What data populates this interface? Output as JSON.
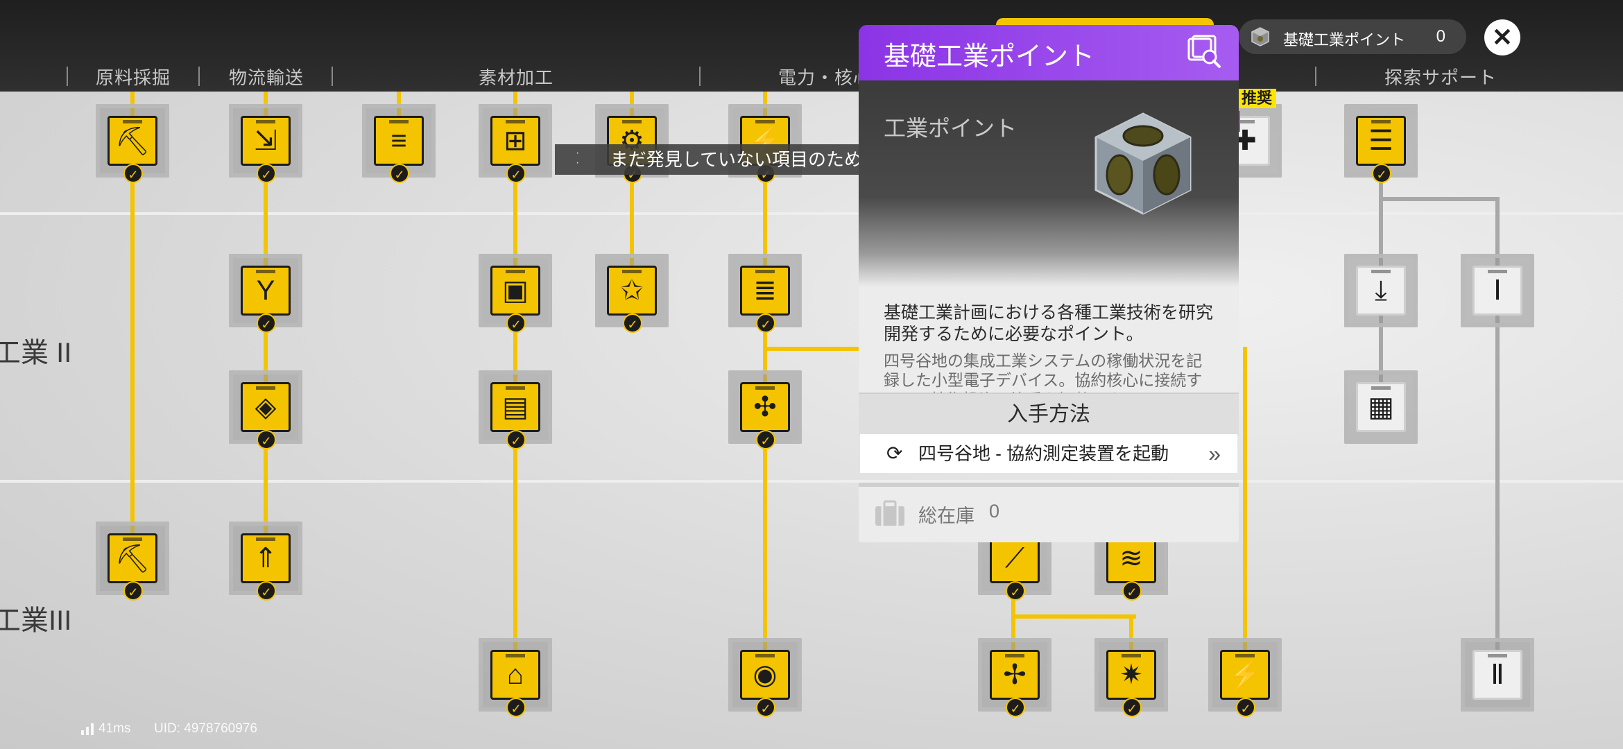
{
  "columns": [
    "原料採掘",
    "物流輸送",
    "素材加工",
    "電力・核心",
    "探索サポート"
  ],
  "row_labels": [
    "工業 II",
    "工業III"
  ],
  "toast": "まだ発見していない項目のため、移動できません",
  "popup": {
    "title": "基礎工業ポイント",
    "category": "工業ポイント",
    "description": "基礎工業計画における各種工業技術を研究開発するために必要なポイント。",
    "flavor": "四号谷地の集成工業システムの稼働状況を記録した小型電子デバイス。協約核心に接続すると、技術投資の比重を調整できる。",
    "acquisition_title": "入手方法",
    "acquisition_item": "四号谷地 - 協約測定装置を起動",
    "stock_label": "総在庫",
    "stock_value": "0"
  },
  "points": {
    "label": "基礎工業ポイント",
    "value": "0"
  },
  "recommend": "推奨",
  "footer": {
    "ping": "41ms",
    "uid": "UID: 4978760976"
  },
  "colors": {
    "accent_yellow": "#f5c400",
    "popup_purple": "#9a4cec",
    "dark_bar": "#222222"
  },
  "icons": {
    "close": "close-icon",
    "search": "search-icon",
    "check": "check-icon",
    "bag": "inventory-icon",
    "route": "route-icon",
    "chevron": "chevron-right-icon",
    "signal": "signal-icon",
    "cube": "industrial-point-cube-icon"
  }
}
